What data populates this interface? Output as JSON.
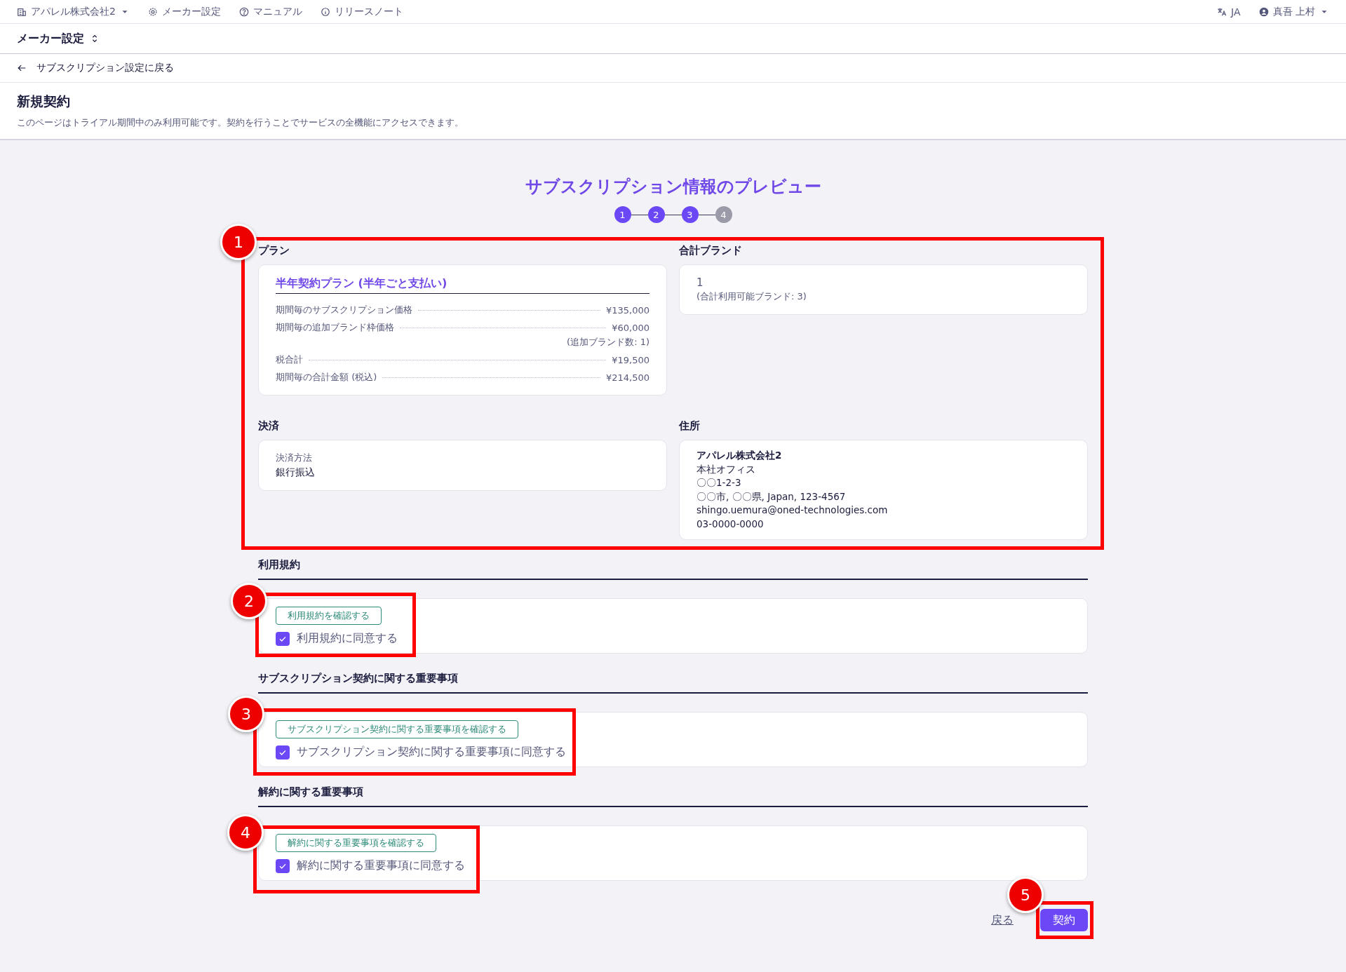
{
  "topbar": {
    "company": "アパレル株式会社2",
    "links": [
      {
        "label": "メーカー設定",
        "kind": "settings"
      },
      {
        "label": "マニュアル",
        "kind": "help"
      },
      {
        "label": "リリースノート",
        "kind": "info"
      }
    ],
    "language": "JA",
    "user": "真吾 上村"
  },
  "context": {
    "label": "メーカー設定"
  },
  "back_link": "サブスクリプション設定に戻る",
  "header": {
    "title": "新規契約",
    "description": "このページはトライアル期間中のみ利用可能です。契約を行うことでサービスの全機能にアクセスできます。"
  },
  "preview": {
    "title": "サブスクリプション情報のプレビュー",
    "steps": [
      {
        "label": "1",
        "completed": true
      },
      {
        "label": "2",
        "completed": true
      },
      {
        "label": "3",
        "completed": true
      },
      {
        "label": "4",
        "completed": false
      }
    ]
  },
  "plan": {
    "heading": "プラン",
    "name": "半年契約プラン (半年ごと支払い)",
    "lines": [
      {
        "label": "期間毎のサブスクリプション価格",
        "value": "¥135,000"
      },
      {
        "label": "期間毎の追加ブランド枠価格",
        "value": "¥60,000",
        "note": "(追加ブランド数: 1)"
      },
      {
        "label": "税合計",
        "value": "¥19,500"
      },
      {
        "label": "期間毎の合計金額 (税込)",
        "value": "¥214,500"
      }
    ]
  },
  "brands": {
    "heading": "合計ブランド",
    "count": "1",
    "note": "(合計利用可能ブランド: 3)"
  },
  "payment": {
    "heading": "決済",
    "label": "決済方法",
    "value": "銀行振込"
  },
  "address": {
    "heading": "住所",
    "company": "アパレル株式会社2",
    "lines": [
      "本社オフィス",
      "〇〇1-2-3",
      "〇〇市, 〇〇県, Japan, 123-4567",
      "shingo.uemura@oned-technologies.com",
      "03-0000-0000"
    ]
  },
  "agreements": [
    {
      "heading": "利用規約",
      "button": "利用規約を確認する",
      "checkbox_label": "利用規約に同意する",
      "checked": true
    },
    {
      "heading": "サブスクリプション契約に関する重要事項",
      "button": "サブスクリプション契約に関する重要事項を確認する",
      "checkbox_label": "サブスクリプション契約に関する重要事項に同意する",
      "checked": true
    },
    {
      "heading": "解約に関する重要事項",
      "button": "解約に関する重要事項を確認する",
      "checkbox_label": "解約に関する重要事項に同意する",
      "checked": true
    }
  ],
  "actions": {
    "back": "戻る",
    "submit": "契約"
  },
  "annotations": [
    {
      "label": "1"
    },
    {
      "label": "2"
    },
    {
      "label": "3"
    },
    {
      "label": "4"
    },
    {
      "label": "5"
    }
  ]
}
